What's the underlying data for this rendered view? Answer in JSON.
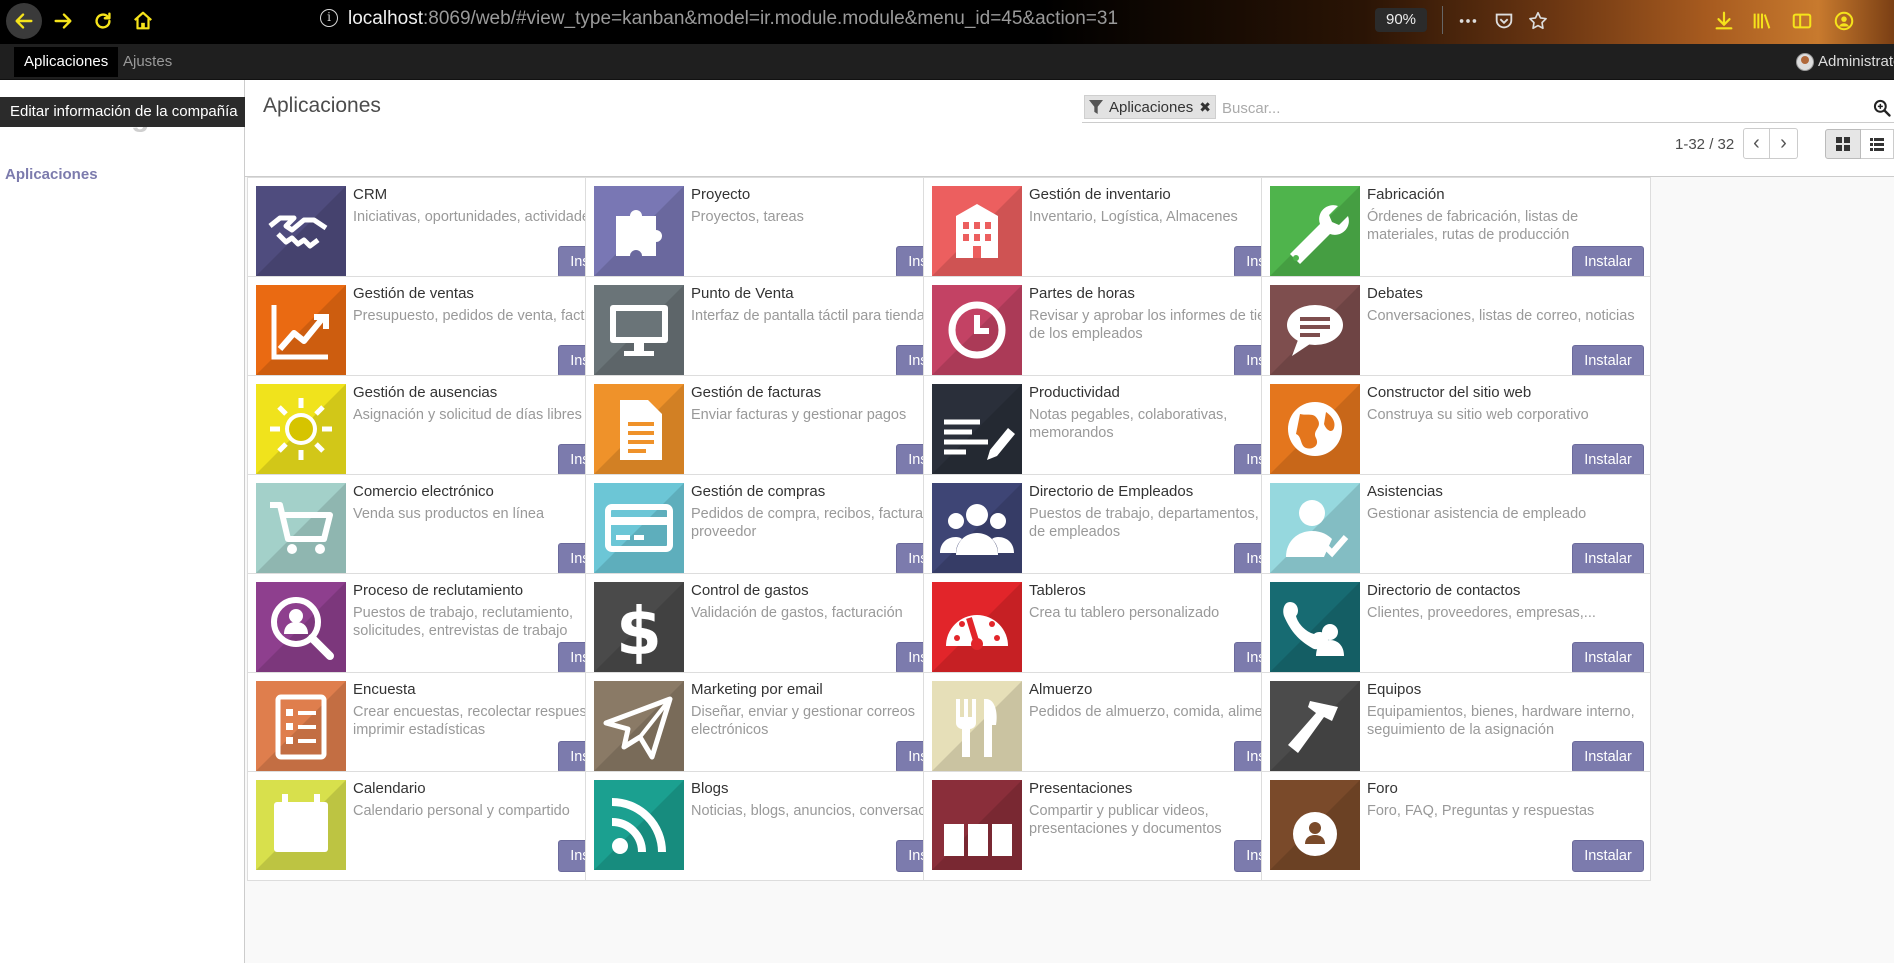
{
  "browser": {
    "url_host": "localhost",
    "url_path": ":8069/web/#view_type=kanban&model=ir.module.module&menu_id=45&action=31",
    "zoom": "90%"
  },
  "nav": {
    "apps_label": "Aplicaciones",
    "settings_label": "Ajustes",
    "user_name": "Administrator"
  },
  "sidebar": {
    "logo_text": "Your logo",
    "tooltip": "Editar información de la compañía",
    "item_label": "Aplicaciones"
  },
  "control_panel": {
    "title": "Aplicaciones",
    "facet_label": "Aplicaciones",
    "search_placeholder": "Buscar...",
    "pager_value": "1-32 / 32"
  },
  "install_label": "Instalar",
  "apps": [
    {
      "title": "CRM",
      "summary": "Iniciativas, oportunidades, actividades",
      "color": "#4f4c7e",
      "icon": "handshake-icon"
    },
    {
      "title": "Proyecto",
      "summary": "Proyectos, tareas",
      "color": "#7977b4",
      "icon": "puzzle-icon"
    },
    {
      "title": "Gestión de inventario",
      "summary": "Inventario, Logística, Almacenes",
      "color": "#ec5f5f",
      "icon": "building-icon"
    },
    {
      "title": "Fabricación",
      "summary": "Órdenes de fabricación, listas de materiales, rutas de producción",
      "color": "#4fb44c",
      "icon": "wrench-icon"
    },
    {
      "title": "Gestión de ventas",
      "summary": "Presupuesto, pedidos de venta, facturación",
      "color": "#ea6a12",
      "icon": "trend-icon"
    },
    {
      "title": "Punto de Venta",
      "summary": "Interfaz de pantalla táctil para tiendas",
      "color": "#6a7478",
      "icon": "monitor-icon"
    },
    {
      "title": "Partes de horas",
      "summary": "Revisar y aprobar los informes de tiempo de los empleados",
      "color": "#c34264",
      "icon": "clock-icon"
    },
    {
      "title": "Debates",
      "summary": "Conversaciones, listas de correo, noticias",
      "color": "#7e4e4e",
      "icon": "chat-bubble-icon"
    },
    {
      "title": "Gestión de ausencias",
      "summary": "Asignación y solicitud de días libres",
      "color": "#f0e31c",
      "icon": "sun-icon"
    },
    {
      "title": "Gestión de facturas",
      "summary": "Enviar facturas y gestionar pagos",
      "color": "#ef922a",
      "icon": "document-icon"
    },
    {
      "title": "Productividad",
      "summary": "Notas pegables, colaborativas, memorandos",
      "color": "#2a2f3a",
      "icon": "pencil-notes-icon"
    },
    {
      "title": "Constructor del sitio web",
      "summary": "Construya su sitio web corporativo",
      "color": "#e4761d",
      "icon": "globe-icon"
    },
    {
      "title": "Comercio electrónico",
      "summary": "Venda sus productos en línea",
      "color": "#a3d0c9",
      "icon": "cart-icon"
    },
    {
      "title": "Gestión de compras",
      "summary": "Pedidos de compra, recibos, facturas de proveedor",
      "color": "#6cc6d6",
      "icon": "credit-card-icon"
    },
    {
      "title": "Directorio de Empleados",
      "summary": "Puestos de trabajo, departamentos, datos de empleados",
      "color": "#3e4575",
      "icon": "group-icon"
    },
    {
      "title": "Asistencias",
      "summary": "Gestionar asistencia de empleado",
      "color": "#96d8de",
      "icon": "user-check-icon"
    },
    {
      "title": "Proceso de reclutamiento",
      "summary": "Puestos de trabajo, reclutamiento, solicitudes, entrevistas de trabajo",
      "color": "#8e3f8e",
      "icon": "magnifier-user-icon"
    },
    {
      "title": "Control de gastos",
      "summary": "Validación de gastos, facturación",
      "color": "#4a4a4a",
      "icon": "dollar-icon"
    },
    {
      "title": "Tableros",
      "summary": "Crea tu tablero personalizado",
      "color": "#e2252a",
      "icon": "gauge-icon"
    },
    {
      "title": "Directorio de contactos",
      "summary": "Clientes, proveedores, empresas,...",
      "color": "#176b72",
      "icon": "contact-phone-icon"
    },
    {
      "title": "Encuesta",
      "summary": "Crear encuestas, recolectar respuestas e imprimir estadísticas",
      "color": "#df7e4d",
      "icon": "checklist-icon"
    },
    {
      "title": "Marketing por email",
      "summary": "Diseñar, enviar y gestionar correos electrónicos",
      "color": "#8a7a66",
      "icon": "paper-plane-icon"
    },
    {
      "title": "Almuerzo",
      "summary": "Pedidos de almuerzo, comida, alimentos",
      "color": "#e6dfb8",
      "icon": "fork-knife-icon"
    },
    {
      "title": "Equipos",
      "summary": "Equipamientos, bienes, hardware interno, seguimiento de la asignación",
      "color": "#4b4b4b",
      "icon": "hammer-icon"
    },
    {
      "title": "Calendario",
      "summary": "Calendario personal y compartido",
      "color": "#d8e04c",
      "icon": "calendar-icon"
    },
    {
      "title": "Blogs",
      "summary": "Noticias, blogs, anuncios, conversaciones",
      "color": "#1ba090",
      "icon": "rss-icon"
    },
    {
      "title": "Presentaciones",
      "summary": "Compartir y publicar videos, presentaciones y documentos",
      "color": "#8a2e3a",
      "icon": "slides-icon"
    },
    {
      "title": "Foro",
      "summary": "Foro, FAQ, Preguntas y respuestas",
      "color": "#7a4a2a",
      "icon": "forum-user-icon"
    }
  ]
}
